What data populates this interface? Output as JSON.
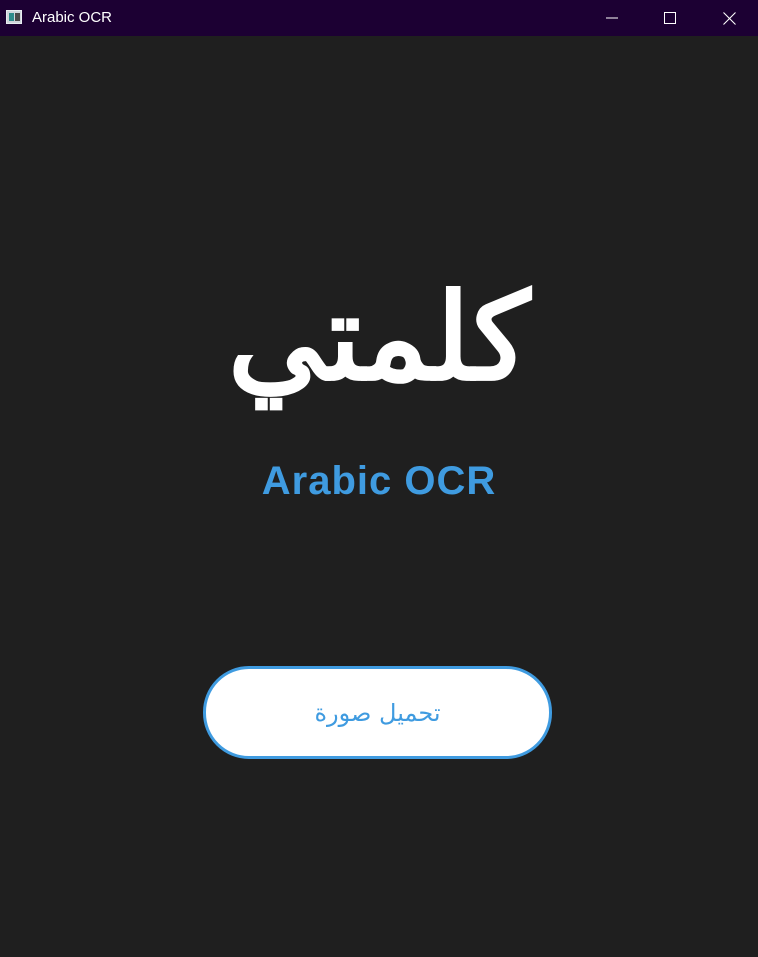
{
  "window": {
    "title": "Arabic OCR",
    "icon": "app-window-icon",
    "controls": {
      "minimize_icon": "minimize-icon",
      "maximize_icon": "maximize-icon",
      "close_icon": "close-icon"
    },
    "titlebar_color": "#1c0033",
    "background_color": "#1f1f1f"
  },
  "main": {
    "logo_text": "كلمتي",
    "subtitle": "Arabic OCR",
    "accent_color": "#3f9be0",
    "upload_button_label": "تحميل صورة"
  }
}
